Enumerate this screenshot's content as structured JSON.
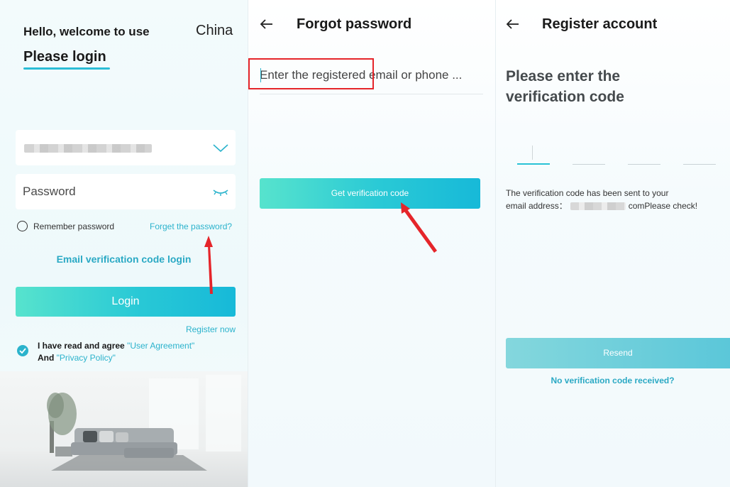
{
  "login": {
    "greeting": "Hello, welcome to use",
    "region": "China",
    "title": "Please login",
    "password_placeholder": "Password",
    "remember_label": "Remember password",
    "forgot_label": "Forget the password?",
    "email_login_label": "Email verification code login",
    "login_button": "Login",
    "register_label": "Register now",
    "agree_prefix": "I have read and agree ",
    "user_agreement": "\"User Agreement\"",
    "and_label": "And ",
    "privacy_policy": "\"Privacy Policy\""
  },
  "forgot": {
    "title": "Forgot password",
    "input_placeholder": "Enter the registered email or phone ...",
    "button": "Get verification code"
  },
  "register": {
    "title": "Register account",
    "heading": "Please enter the verification code",
    "note_line1": "The verification code has been sent to your",
    "note_prefix": "email address：",
    "note_suffix": "comPlease check!",
    "resend_button": "Resend",
    "no_code_link": "No verification code received?"
  },
  "colors": {
    "accent": "#2bb3cc",
    "gradient_start": "#57e3cd",
    "gradient_end": "#17b9d8",
    "annotation_red": "#e5252a"
  },
  "icons": [
    "chevron-down-icon",
    "eye-closed-icon",
    "back-arrow-icon",
    "checkmark-icon"
  ]
}
